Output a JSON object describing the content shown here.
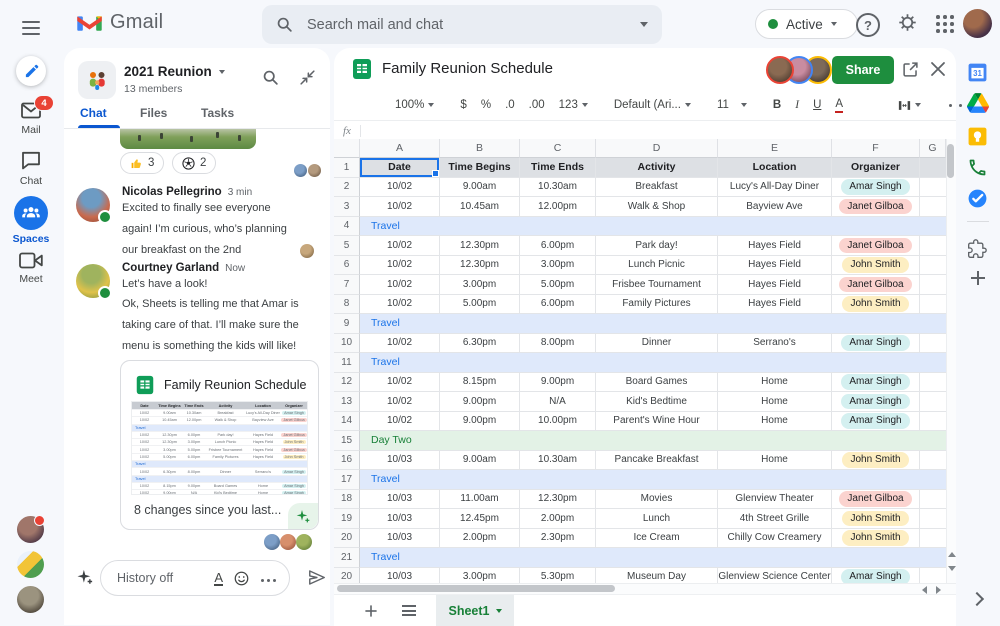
{
  "topbar": {
    "product": "Gmail",
    "search_placeholder": "Search mail and chat",
    "status": "Active"
  },
  "left_rail": {
    "items": [
      {
        "label": "Mail",
        "badge": "4"
      },
      {
        "label": "Chat"
      },
      {
        "label": "Spaces",
        "active": true
      },
      {
        "label": "Meet"
      }
    ]
  },
  "chat": {
    "space_name": "2021 Reunion",
    "members": "13 members",
    "tabs": [
      "Chat",
      "Files",
      "Tasks"
    ],
    "active_tab": "Chat",
    "reactions": [
      {
        "icon": "thumbs-up",
        "count": "3"
      },
      {
        "icon": "soccer-ball",
        "count": "2"
      }
    ],
    "messages": [
      {
        "name": "Nicolas Pellegrino",
        "time": "3 min",
        "text": "Excited to finally see everyone\nagain! I’m curious, who’s planning\nour breakfast on the 2nd"
      },
      {
        "name": "Courtney Garland",
        "time": "Now",
        "text": "Let’s have a look!",
        "text2": "Ok, Sheets is telling me that Amar is\ntaking care of that. I’ll make sure the\nmenu is something the kids will like!"
      }
    ],
    "card": {
      "title": "Family Reunion Schedule",
      "footer": "8 changes since you last..."
    },
    "input_placeholder": "History off"
  },
  "sheet": {
    "title": "Family Reunion Schedule",
    "share_label": "Share",
    "toolbar": {
      "zoom": "100%",
      "currency": "$",
      "percent": "%",
      "dec0": ".0",
      "dec00": ".00",
      "fmt": "123",
      "font": "Default (Ari...",
      "size": "11"
    },
    "fx": "fx",
    "columns": [
      "A",
      "B",
      "C",
      "D",
      "E",
      "F",
      "G"
    ],
    "headers": [
      "Date",
      "Time Begins",
      "Time Ends",
      "Activity",
      "Location",
      "Organizer"
    ],
    "rows": [
      {
        "n": "2",
        "date": "10/02",
        "begins": "9.00am",
        "ends": "10.30am",
        "activity": "Breakfast",
        "location": "Lucy's All-Day Diner",
        "organizer": "Amar Singh",
        "chip": "cyan"
      },
      {
        "n": "3",
        "date": "10/02",
        "begins": "10.45am",
        "ends": "12.00pm",
        "activity": "Walk & Shop",
        "location": "Bayview Ave",
        "organizer": "Janet Gilboa",
        "chip": "pink"
      },
      {
        "n": "4",
        "band": "travel",
        "label": "Travel"
      },
      {
        "n": "5",
        "date": "10/02",
        "begins": "12.30pm",
        "ends": "6.00pm",
        "activity": "Park day!",
        "location": "Hayes Field",
        "organizer": "Janet Gilboa",
        "chip": "pink"
      },
      {
        "n": "6",
        "date": "10/02",
        "begins": "12.30pm",
        "ends": "3.00pm",
        "activity": "Lunch Picnic",
        "location": "Hayes Field",
        "organizer": "John Smith",
        "chip": "yellow"
      },
      {
        "n": "7",
        "date": "10/02",
        "begins": "3.00pm",
        "ends": "5.00pm",
        "activity": "Frisbee Tournament",
        "location": "Hayes Field",
        "organizer": "Janet Gilboa",
        "chip": "pink"
      },
      {
        "n": "8",
        "date": "10/02",
        "begins": "5.00pm",
        "ends": "6.00pm",
        "activity": "Family Pictures",
        "location": "Hayes Field",
        "organizer": "John Smith",
        "chip": "yellow"
      },
      {
        "n": "9",
        "band": "travel",
        "label": "Travel"
      },
      {
        "n": "10",
        "date": "10/02",
        "begins": "6.30pm",
        "ends": "8.00pm",
        "activity": "Dinner",
        "location": "Serrano's",
        "organizer": "Amar Singh",
        "chip": "cyan"
      },
      {
        "n": "11",
        "band": "travel",
        "label": "Travel"
      },
      {
        "n": "12",
        "date": "10/02",
        "begins": "8.15pm",
        "ends": "9.00pm",
        "activity": "Board Games",
        "location": "Home",
        "organizer": "Amar Singh",
        "chip": "cyan"
      },
      {
        "n": "13",
        "date": "10/02",
        "begins": "9.00pm",
        "ends": "N/A",
        "activity": "Kid's Bedtime",
        "location": "Home",
        "organizer": "Amar Singh",
        "chip": "cyan"
      },
      {
        "n": "14",
        "date": "10/02",
        "begins": "9.00pm",
        "ends": "10.00pm",
        "activity": "Parent's Wine Hour",
        "location": "Home",
        "organizer": "Amar Singh",
        "chip": "cyan"
      },
      {
        "n": "15",
        "band": "daytwo",
        "label": "Day Two"
      },
      {
        "n": "16",
        "date": "10/03",
        "begins": "9.00am",
        "ends": "10.30am",
        "activity": "Pancake Breakfast",
        "location": "Home",
        "organizer": "John Smith",
        "chip": "yellow"
      },
      {
        "n": "17",
        "band": "travel",
        "label": "Travel"
      },
      {
        "n": "18",
        "date": "10/03",
        "begins": "11.00am",
        "ends": "12.30pm",
        "activity": "Movies",
        "location": "Glenview Theater",
        "organizer": "Janet Gilboa",
        "chip": "pink"
      },
      {
        "n": "19",
        "date": "10/03",
        "begins": "12.45pm",
        "ends": "2.00pm",
        "activity": "Lunch",
        "location": "4th Street Grille",
        "organizer": "John Smith",
        "chip": "yellow"
      },
      {
        "n": "20",
        "date": "10/03",
        "begins": "2.00pm",
        "ends": "2.30pm",
        "activity": "Ice Cream",
        "location": "Chilly Cow Creamery",
        "organizer": "John Smith",
        "chip": "yellow"
      },
      {
        "n": "21",
        "band": "travel",
        "label": "Travel"
      },
      {
        "n": "20",
        "date": "10/03",
        "begins": "3.00pm",
        "ends": "5.30pm",
        "activity": "Museum Day",
        "location": "Glenview Science Center",
        "organizer": "Amar Singh",
        "chip": "cyan",
        "partial": true
      }
    ],
    "tab": "Sheet1"
  },
  "right_panel": {
    "icons": [
      "calendar",
      "drive",
      "keep",
      "voice",
      "tasks",
      "addons",
      "add",
      "expand"
    ]
  },
  "colors": {
    "accent_blue": "#1a73e8",
    "share_green": "#1e8e3e",
    "badge_red": "#e94235",
    "travel_bg": "#dfe9fb",
    "daytwo_bg": "#e3f2e6",
    "chip_cyan": "#d4f0f0",
    "chip_pink": "#fbd3cf",
    "chip_yellow": "#fdeec2"
  }
}
